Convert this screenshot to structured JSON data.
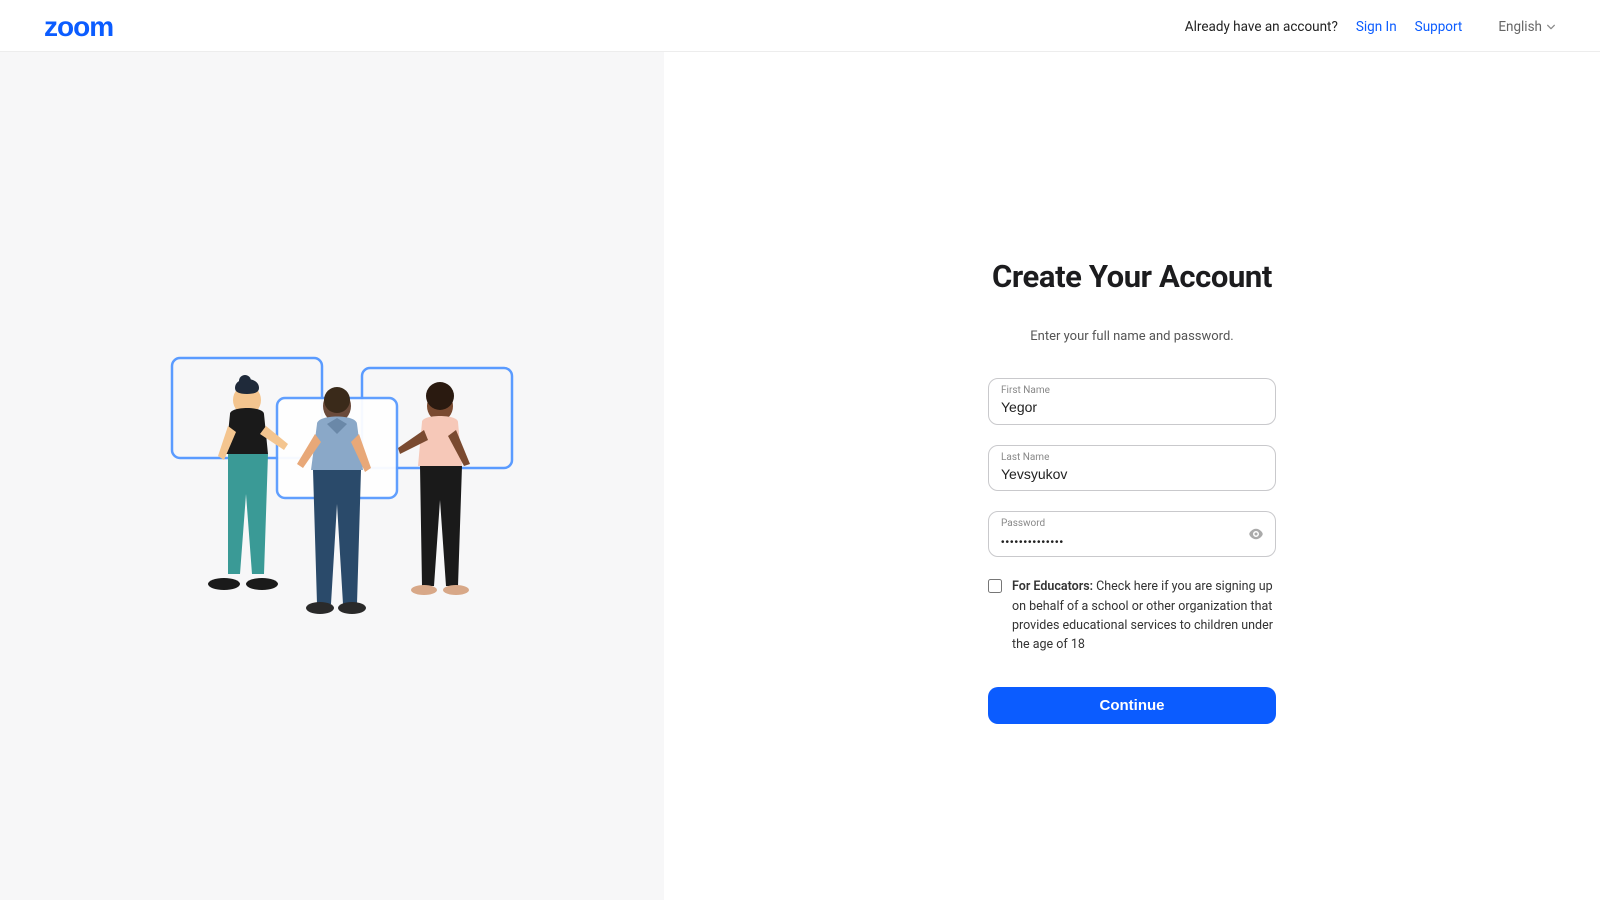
{
  "header": {
    "logo_text": "zoom",
    "already_text": "Already have an account?",
    "signin_label": "Sign In",
    "support_label": "Support",
    "language_label": "English"
  },
  "form": {
    "title": "Create Your Account",
    "subtitle": "Enter your full name and password.",
    "first_name_label": "First Name",
    "first_name_value": "Yegor",
    "last_name_label": "Last Name",
    "last_name_value": "Yevsyukov",
    "password_label": "Password",
    "password_value": "••••••••••••••",
    "educator_bold": "For Educators:",
    "educator_text": " Check here if you are signing up on behalf of a school or other organization that provides educational services to children under the age of 18",
    "continue_label": "Continue"
  }
}
